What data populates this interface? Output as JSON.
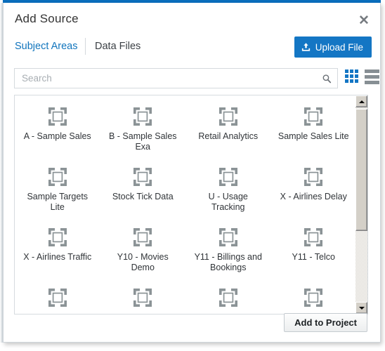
{
  "theme": {
    "accent_blue": "#0a6ebd",
    "link_blue": "#1175bd",
    "button_blue": "#1476c4",
    "icon_gray": "#878f94",
    "text_dark": "#303438"
  },
  "dialog": {
    "title": "Add Source",
    "close_label": "✕"
  },
  "tabs": [
    {
      "label": "Subject Areas",
      "active": true
    },
    {
      "label": "Data Files",
      "active": false
    }
  ],
  "toolbar": {
    "upload_label": "Upload File",
    "upload_icon": "upload-tray-icon"
  },
  "search": {
    "value": "",
    "placeholder": "Search",
    "icon": "magnifier-icon"
  },
  "view_toggle": {
    "grid_icon": "grid-view-icon",
    "list_icon": "list-view-icon",
    "selected": "grid"
  },
  "grid": {
    "item_icon": "subject-area-icon",
    "items": [
      {
        "label": "A - Sample Sales"
      },
      {
        "label": "B - Sample Sales Exa"
      },
      {
        "label": "Retail Analytics"
      },
      {
        "label": "Sample Sales Lite"
      },
      {
        "label": "Sample Targets Lite"
      },
      {
        "label": "Stock Tick Data"
      },
      {
        "label": "U - Usage Tracking"
      },
      {
        "label": "X - Airlines Delay"
      },
      {
        "label": "X - Airlines Traffic"
      },
      {
        "label": "Y10 - Movies Demo"
      },
      {
        "label": "Y11 - Billings and Bookings"
      },
      {
        "label": "Y11 - Telco"
      },
      {
        "label": ""
      },
      {
        "label": ""
      },
      {
        "label": ""
      },
      {
        "label": ""
      }
    ]
  },
  "scrollbar": {
    "up_arrow": "scroll-up-arrow-icon",
    "down_arrow": "scroll-down-arrow-icon"
  },
  "footer": {
    "add_label": "Add to Project"
  }
}
